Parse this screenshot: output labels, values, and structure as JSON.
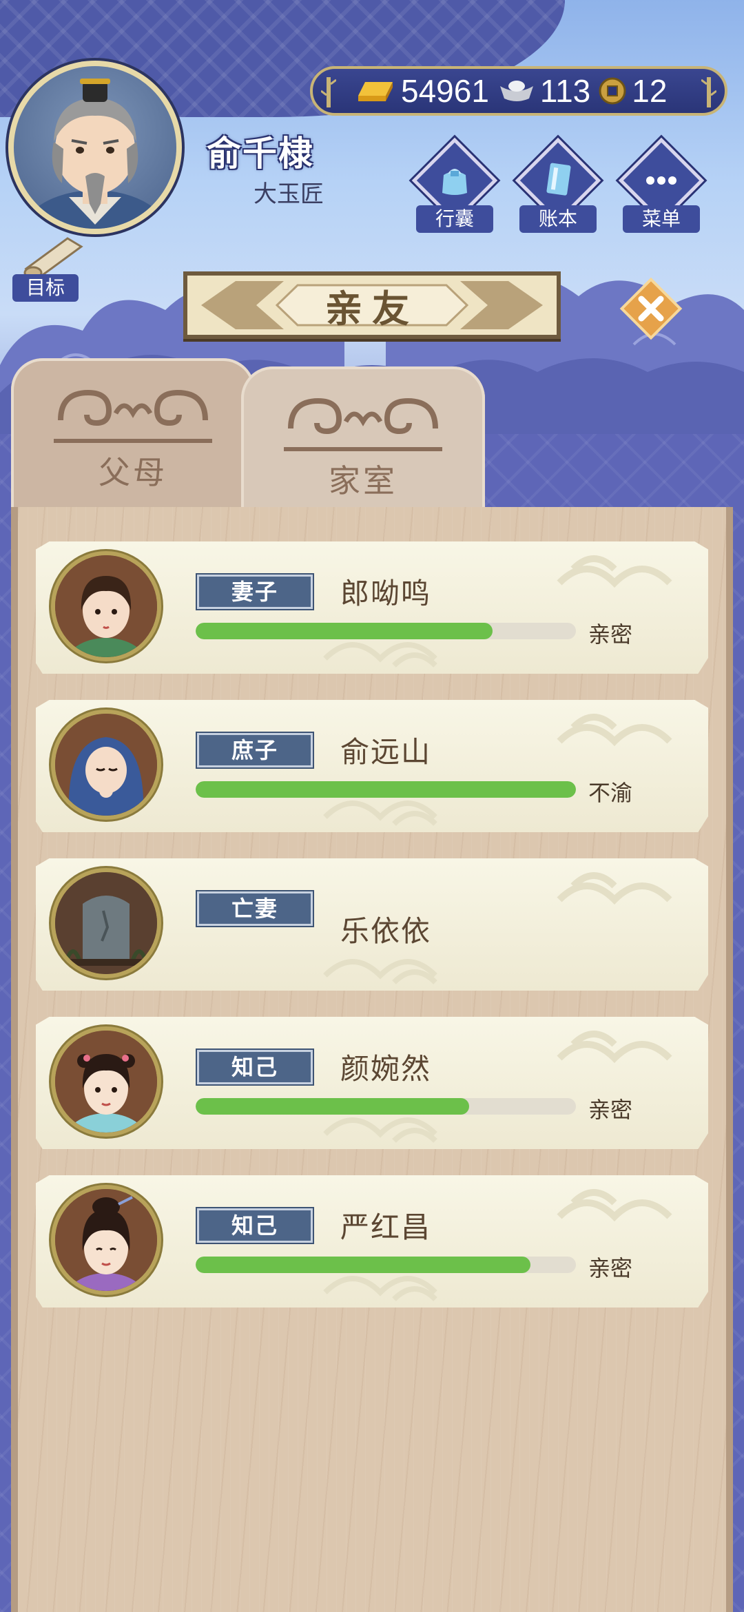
{
  "player": {
    "name": "俞千棣",
    "title": "大玉匠"
  },
  "currency": {
    "gold": "54961",
    "silver": "113",
    "coins": "12"
  },
  "menu": {
    "bag": "行囊",
    "ledger": "账本",
    "menu": "菜单",
    "goal": "目标"
  },
  "banner": {
    "title": "亲友"
  },
  "tabs": {
    "parents": "父母",
    "household": "家室",
    "active": "household"
  },
  "relations": [
    {
      "tag": "妻子",
      "name": "郎呦鸣",
      "status": "亲密",
      "level": 0.78
    },
    {
      "tag": "庶子",
      "name": "俞远山",
      "status": "不渝",
      "level": 1.0
    },
    {
      "tag": "亡妻",
      "name": "乐依依",
      "status": "",
      "level": null
    },
    {
      "tag": "知己",
      "name": "颜婉然",
      "status": "亲密",
      "level": 0.72
    },
    {
      "tag": "知己",
      "name": "严红昌",
      "status": "亲密",
      "level": 0.88
    }
  ],
  "colors": {
    "accent_blue": "#4d6588",
    "bar_green": "#6cc04a",
    "panel_wood": "#dcc7af"
  }
}
